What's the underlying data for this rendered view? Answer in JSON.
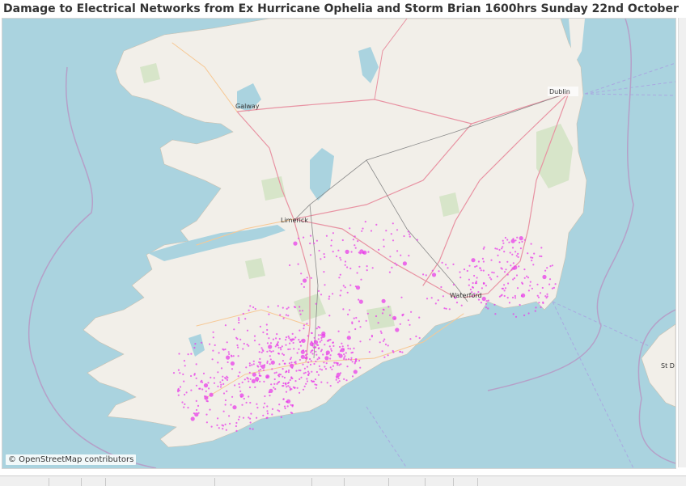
{
  "dashboard": {
    "title": "Damage to Electrical Networks from Ex Hurricane Ophelia and Storm Brian 1600hrs Sunday 22nd October"
  },
  "map": {
    "attribution": "© OpenStreetMap contributors",
    "place_labels": [
      "Dublin",
      "Galway",
      "Limerick",
      "Waterford",
      "St D"
    ],
    "colors": {
      "sea": "#aad3df",
      "land": "#f2efe9",
      "border": "#b5a0c8",
      "fault_marker": "#e83ee8"
    }
  }
}
